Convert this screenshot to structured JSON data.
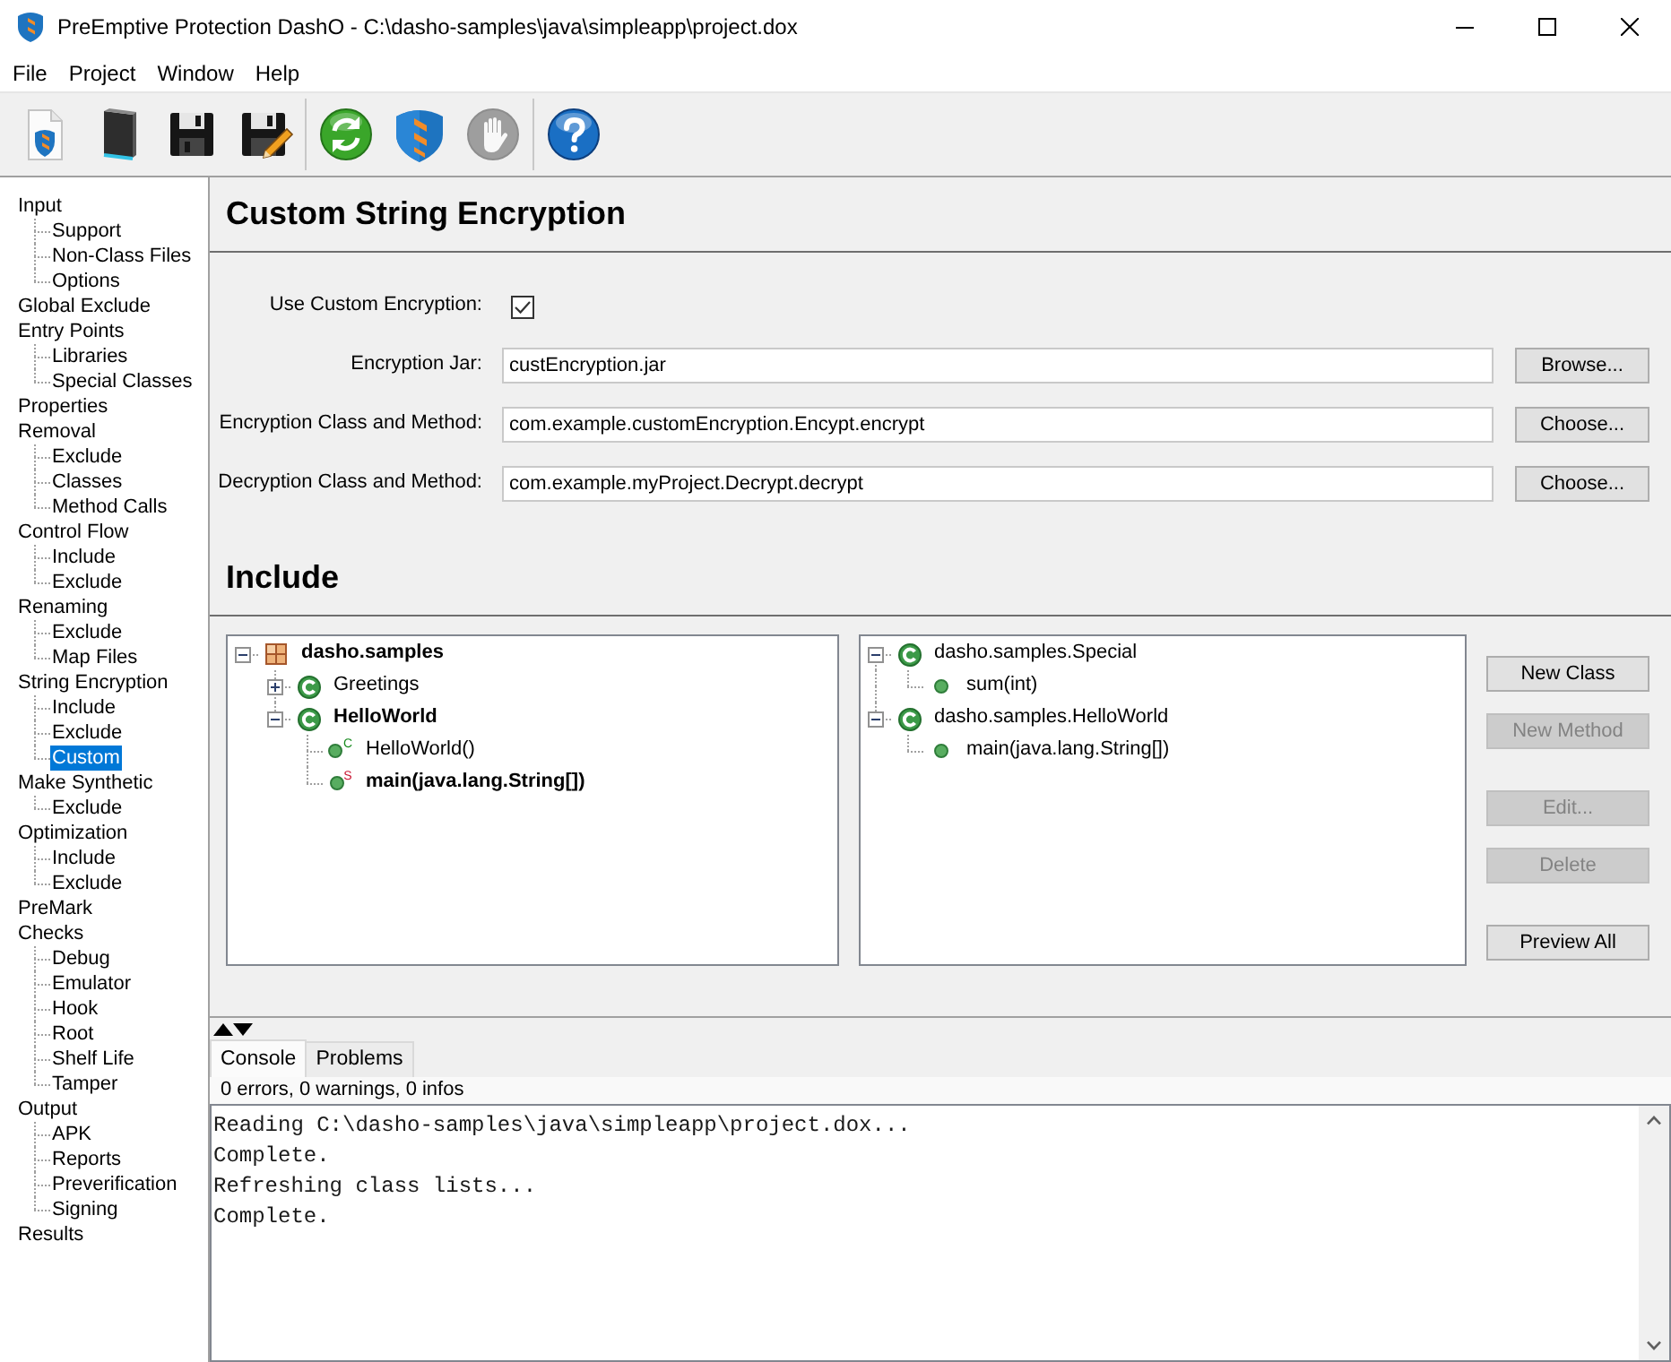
{
  "window": {
    "title": "PreEmptive Protection DashO - C:\\dasho-samples\\java\\simpleapp\\project.dox"
  },
  "menu": [
    {
      "label": "File"
    },
    {
      "label": "Project"
    },
    {
      "label": "Window"
    },
    {
      "label": "Help"
    }
  ],
  "toolbar": [
    [
      {
        "disabled": false
      },
      {
        "disabled": false
      },
      {
        "disabled": false
      },
      {
        "disabled": false
      }
    ],
    [
      {
        "disabled": false
      },
      {
        "disabled": false
      },
      {
        "disabled": true
      }
    ],
    [
      {
        "disabled": false
      }
    ]
  ],
  "sidebar": {
    "items": [
      {
        "label": "Input",
        "selected": false,
        "children": [
          {
            "label": "Support",
            "selected": false
          },
          {
            "label": "Non-Class Files",
            "selected": false
          },
          {
            "label": "Options",
            "selected": false
          }
        ]
      },
      {
        "label": "Global Exclude",
        "selected": false
      },
      {
        "label": "Entry Points",
        "selected": false,
        "children": [
          {
            "label": "Libraries",
            "selected": false
          },
          {
            "label": "Special Classes",
            "selected": false
          }
        ]
      },
      {
        "label": "Properties",
        "selected": false
      },
      {
        "label": "Removal",
        "selected": false,
        "children": [
          {
            "label": "Exclude",
            "selected": false
          },
          {
            "label": "Classes",
            "selected": false
          },
          {
            "label": "Method Calls",
            "selected": false
          }
        ]
      },
      {
        "label": "Control Flow",
        "selected": false,
        "children": [
          {
            "label": "Include",
            "selected": false
          },
          {
            "label": "Exclude",
            "selected": false
          }
        ]
      },
      {
        "label": "Renaming",
        "selected": false,
        "children": [
          {
            "label": "Exclude",
            "selected": false
          },
          {
            "label": "Map Files",
            "selected": false
          }
        ]
      },
      {
        "label": "String Encryption",
        "selected": false,
        "children": [
          {
            "label": "Include",
            "selected": false
          },
          {
            "label": "Exclude",
            "selected": false
          },
          {
            "label": "Custom",
            "selected": true
          }
        ]
      },
      {
        "label": "Make Synthetic",
        "selected": false,
        "children": [
          {
            "label": "Exclude",
            "selected": false
          }
        ]
      },
      {
        "label": "Optimization",
        "selected": false,
        "children": [
          {
            "label": "Include",
            "selected": false
          },
          {
            "label": "Exclude",
            "selected": false
          }
        ]
      },
      {
        "label": "PreMark",
        "selected": false
      },
      {
        "label": "Checks",
        "selected": false,
        "children": [
          {
            "label": "Debug",
            "selected": false
          },
          {
            "label": "Emulator",
            "selected": false
          },
          {
            "label": "Hook",
            "selected": false
          },
          {
            "label": "Root",
            "selected": false
          },
          {
            "label": "Shelf Life",
            "selected": false
          },
          {
            "label": "Tamper",
            "selected": false
          }
        ]
      },
      {
        "label": "Output",
        "selected": false,
        "children": [
          {
            "label": "APK",
            "selected": false
          },
          {
            "label": "Reports",
            "selected": false
          },
          {
            "label": "Preverification",
            "selected": false
          },
          {
            "label": "Signing",
            "selected": false
          }
        ]
      },
      {
        "label": "Results",
        "selected": false
      }
    ]
  },
  "page": {
    "title": "Custom String Encryption"
  },
  "form": {
    "use_custom_encryption": {
      "label": "Use Custom Encryption:",
      "checked": true
    },
    "fields": [
      {
        "label": "Encryption Jar:",
        "value": "custEncryption.jar",
        "button": "Browse..."
      },
      {
        "label": "Encryption Class and Method:",
        "value": "com.example.customEncryption.Encypt.encrypt",
        "button": "Choose..."
      },
      {
        "label": "Decryption Class and Method:",
        "value": "com.example.myProject.Decrypt.decrypt",
        "button": "Choose..."
      }
    ]
  },
  "include": {
    "title": "Include",
    "left_tree": [
      {
        "label": "dasho.samples",
        "kind": "package",
        "bold": true,
        "expanded": true,
        "children": [
          {
            "label": "Greetings",
            "kind": "class",
            "bold": false,
            "expanded": false
          },
          {
            "label": "HelloWorld",
            "kind": "class",
            "bold": true,
            "expanded": true,
            "children": [
              {
                "label": "HelloWorld()",
                "kind": "constructor",
                "modifier": "C",
                "bold": false
              },
              {
                "label": "main(java.lang.String[])",
                "kind": "static_method",
                "modifier": "S",
                "bold": true
              }
            ]
          }
        ]
      }
    ],
    "right_tree": [
      {
        "label": "dasho.samples.Special",
        "kind": "class",
        "bold": false,
        "expanded": true,
        "children": [
          {
            "label": "sum(int)",
            "kind": "method",
            "bold": false
          }
        ]
      },
      {
        "label": "dasho.samples.HelloWorld",
        "kind": "class",
        "bold": false,
        "expanded": true,
        "children": [
          {
            "label": "main(java.lang.String[])",
            "kind": "method",
            "bold": false
          }
        ]
      }
    ],
    "button_groups": [
      [
        {
          "label": "New Class",
          "disabled": false
        },
        {
          "label": "New Method",
          "disabled": true
        }
      ],
      [
        {
          "label": "Edit...",
          "disabled": true
        },
        {
          "label": "Delete",
          "disabled": true
        }
      ],
      [
        {
          "label": "Preview All",
          "disabled": false
        }
      ]
    ]
  },
  "console": {
    "tabs": [
      {
        "label": "Console",
        "selected": true
      },
      {
        "label": "Problems",
        "selected": false
      }
    ],
    "summary": "0 errors, 0 warnings, 0 infos",
    "lines": [
      "Reading C:\\dasho-samples\\java\\simpleapp\\project.dox...",
      "Complete.",
      "Refreshing class lists...",
      "Complete."
    ]
  }
}
